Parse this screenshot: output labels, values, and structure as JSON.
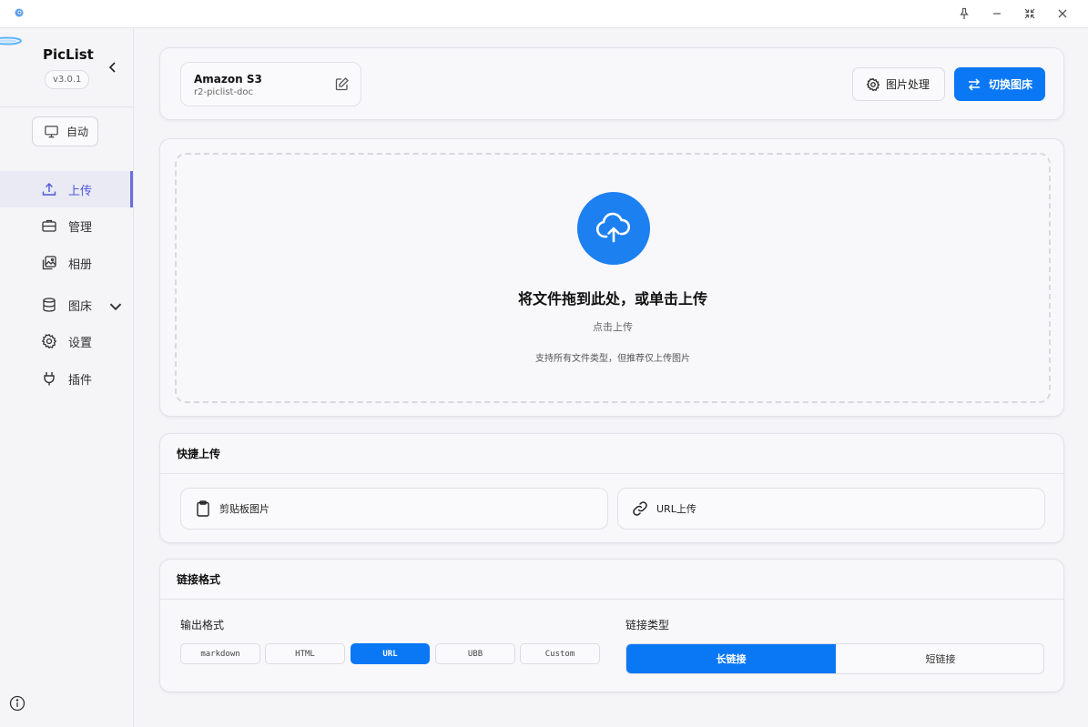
{
  "app": {
    "name": "PicList",
    "version": "v3.0.1"
  },
  "titlebar": {
    "icons": [
      "app-icon",
      "pin-icon",
      "minimize-icon",
      "shrink-icon",
      "close-icon"
    ]
  },
  "sidebar": {
    "theme_label": "自动",
    "items": [
      {
        "label": "上传",
        "icon": "upload-icon",
        "active": true
      },
      {
        "label": "管理",
        "icon": "briefcase-icon"
      },
      {
        "label": "相册",
        "icon": "gallery-icon"
      },
      {
        "label": "图床",
        "icon": "database-icon"
      },
      {
        "label": "设置",
        "icon": "gear-icon"
      },
      {
        "label": "插件",
        "icon": "plug-icon"
      }
    ]
  },
  "header": {
    "pic_bed_name": "Amazon S3",
    "pic_bed_config": "r2-piclist-doc",
    "image_process_label": "图片处理",
    "switch_label": "切换图床"
  },
  "upload": {
    "title": "将文件拖到此处，或单击上传",
    "click_text": "点击上传",
    "hint": "支持所有文件类型，但推荐仅上传图片"
  },
  "quick_upload": {
    "title": "快捷上传",
    "clipboard_label": "剪贴板图片",
    "url_label": "URL上传"
  },
  "link_format": {
    "title": "链接格式",
    "output_label": "输出格式",
    "formats": [
      "markdown",
      "HTML",
      "URL",
      "UBB",
      "Custom"
    ],
    "selected_format": "URL",
    "link_type_label": "链接类型",
    "link_types": [
      "长链接",
      "短链接"
    ],
    "selected_link_type": "长链接"
  },
  "colors": {
    "accent": "#0a78f5",
    "nav_active": "#4b58d6"
  }
}
